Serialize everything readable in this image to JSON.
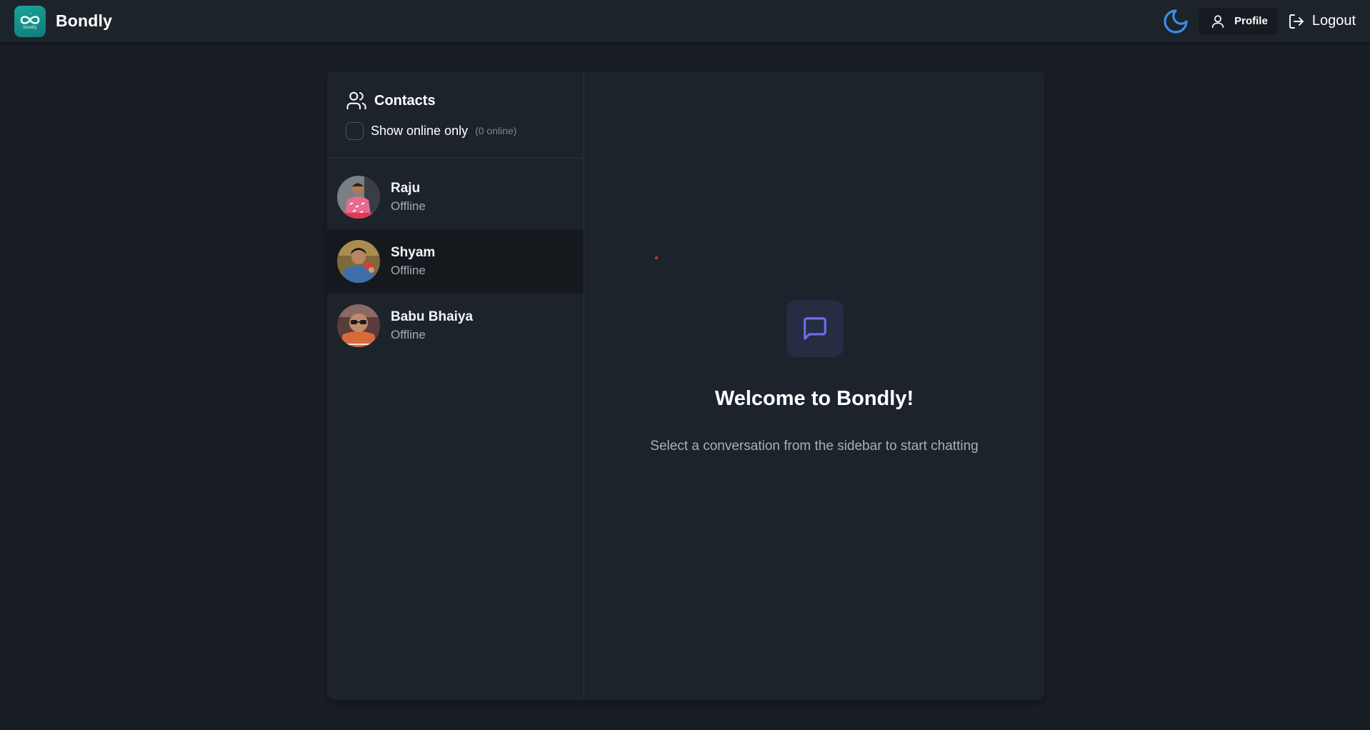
{
  "app": {
    "name": "Bondly",
    "logo_caption": "bondly"
  },
  "navbar": {
    "theme_toggle_icon": "moon-icon",
    "profile_label": "Profile",
    "logout_label": "Logout",
    "accent_color": "#3b8fe8"
  },
  "sidebar": {
    "title": "Contacts",
    "filter_label": "Show online only",
    "online_count": "(0 online)",
    "contacts": [
      {
        "name": "Raju",
        "status": "Offline",
        "active": false
      },
      {
        "name": "Shyam",
        "status": "Offline",
        "active": true
      },
      {
        "name": "Babu Bhaiya",
        "status": "Offline",
        "active": false
      }
    ]
  },
  "welcome": {
    "icon": "message-square-icon",
    "title": "Welcome to Bondly!",
    "subtitle": "Select a conversation from the sidebar to start chatting",
    "icon_color": "#6e6cf0"
  }
}
